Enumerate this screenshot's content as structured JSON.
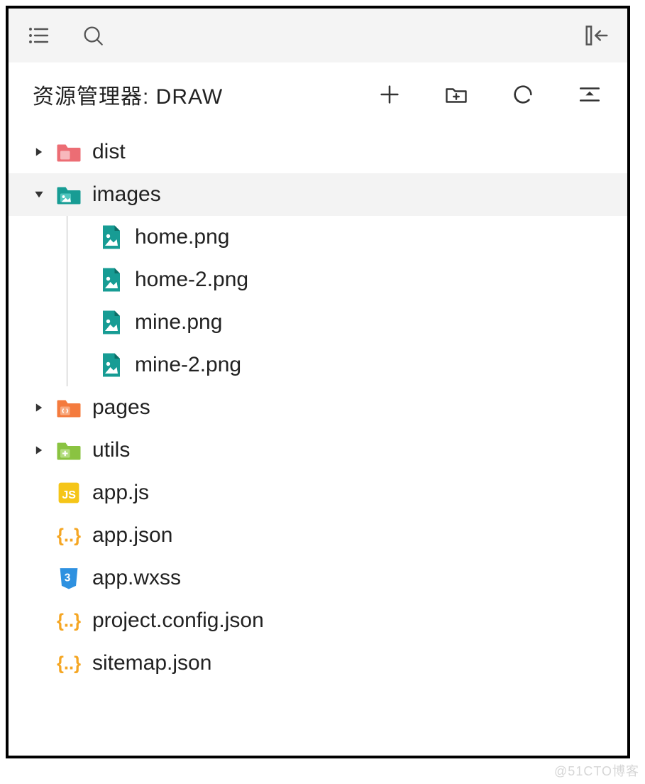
{
  "explorer_title": "资源管理器: DRAW",
  "tree": {
    "dist": "dist",
    "images": "images",
    "images_children": {
      "home_png": "home.png",
      "home2_png": "home-2.png",
      "mine_png": "mine.png",
      "mine2_png": "mine-2.png"
    },
    "pages": "pages",
    "utils": "utils",
    "app_js": "app.js",
    "app_json": "app.json",
    "app_wxss": "app.wxss",
    "project_config_json": "project.config.json",
    "sitemap_json": "sitemap.json"
  },
  "watermark": "@51CTO博客"
}
